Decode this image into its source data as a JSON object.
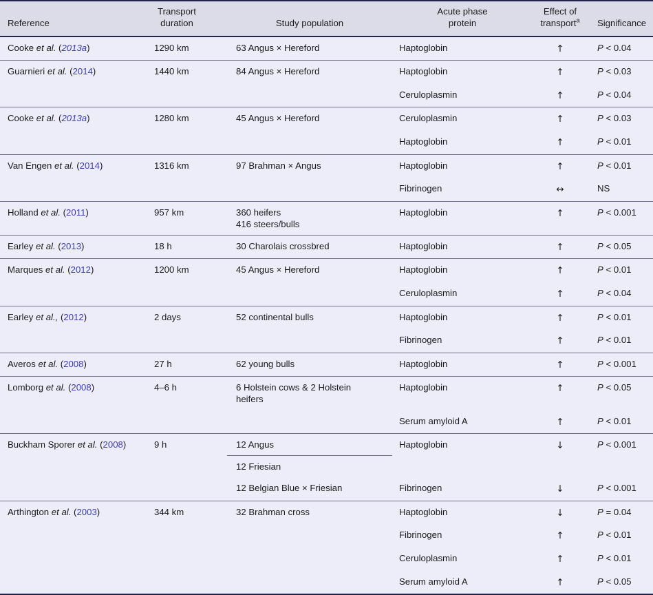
{
  "table": {
    "caption_present": false,
    "columns": [
      {
        "key": "reference",
        "label_line1": "Reference",
        "label_line2": ""
      },
      {
        "key": "duration",
        "label_line1": "Transport",
        "label_line2": "duration"
      },
      {
        "key": "population",
        "label_line1": "Study population",
        "label_line2": ""
      },
      {
        "key": "protein",
        "label_line1": "Acute phase",
        "label_line2": "protein"
      },
      {
        "key": "effect",
        "label_line1": "Effect of",
        "label_line2": "transport",
        "footnote_marker": "a"
      },
      {
        "key": "significance",
        "label_line1": "Significance",
        "label_line2": ""
      }
    ],
    "colors": {
      "header_bg": "#dcdce8",
      "body_bg": "#ededfa",
      "rule_strong": "#23234a",
      "rule_light": "#6e6e86",
      "citation_link": "#3b3bbf",
      "text": "#1a1a1a"
    },
    "symbols": {
      "increase": "↑",
      "decrease": "↓",
      "no_change": "↔",
      "times": "×"
    },
    "rows": [
      {
        "reference": {
          "author": "Cooke et al.",
          "year": "2013a",
          "italic_year": true
        },
        "duration": "1290 km",
        "population": "63 Angus × Hereford",
        "protein": "Haptoglobin",
        "effect": "↑",
        "significance": "P < 0.04",
        "new_group": true
      },
      {
        "reference": {
          "author": "Guarnieri et al.",
          "year": "2014",
          "italic_year": false
        },
        "duration": "1440 km",
        "population": "84 Angus × Hereford",
        "protein": "Haptoglobin",
        "effect": "↑",
        "significance": "P < 0.03",
        "new_group": true
      },
      {
        "reference": {
          "author": "",
          "year": "",
          "italic_year": false
        },
        "duration": "",
        "population": "",
        "protein": "Ceruloplasmin",
        "effect": "↑",
        "significance": "P < 0.04",
        "new_group": false
      },
      {
        "reference": {
          "author": "Cooke et al.",
          "year": "2013a",
          "italic_year": true
        },
        "duration": "1280 km",
        "population": "45 Angus × Hereford",
        "protein": "Ceruloplasmin",
        "effect": "↑",
        "significance": "P < 0.03",
        "new_group": true
      },
      {
        "reference": {
          "author": "",
          "year": "",
          "italic_year": false
        },
        "duration": "",
        "population": "",
        "protein": "Haptoglobin",
        "effect": "↑",
        "significance": "P < 0.01",
        "new_group": false
      },
      {
        "reference": {
          "author": "Van Engen et al.",
          "year": "2014",
          "italic_year": false
        },
        "duration": "1316 km",
        "population": "97 Brahman × Angus",
        "protein": "Haptoglobin",
        "effect": "↑",
        "significance": "P < 0.01",
        "new_group": true
      },
      {
        "reference": {
          "author": "",
          "year": "",
          "italic_year": false
        },
        "duration": "",
        "population": "",
        "protein": "Fibrinogen",
        "effect": "↔",
        "significance": "NS",
        "new_group": false
      },
      {
        "reference": {
          "author": "Holland et al.",
          "year": "2011",
          "italic_year": false
        },
        "duration": "957 km",
        "population": "360 heifers\n416 steers/bulls",
        "protein": "Haptoglobin",
        "effect": "↑",
        "significance": "P < 0.001",
        "new_group": true
      },
      {
        "reference": {
          "author": "Earley et al.",
          "year": "2013",
          "italic_year": false
        },
        "duration": "18 h",
        "population": "30 Charolais crossbred",
        "protein": "Haptoglobin",
        "effect": "↑",
        "significance": "P < 0.05",
        "new_group": true
      },
      {
        "reference": {
          "author": "Marques et al.",
          "year": "2012",
          "italic_year": false
        },
        "duration": "1200 km",
        "population": "45 Angus × Hereford",
        "protein": "Haptoglobin",
        "effect": "↑",
        "significance": "P < 0.01",
        "new_group": true
      },
      {
        "reference": {
          "author": "",
          "year": "",
          "italic_year": false
        },
        "duration": "",
        "population": "",
        "protein": "Ceruloplasmin",
        "effect": "↑",
        "significance": "P < 0.04",
        "new_group": false
      },
      {
        "reference": {
          "author": "Earley et al.,",
          "year": "2012",
          "italic_year": false
        },
        "duration": "2 days",
        "population": "52 continental bulls",
        "protein": "Haptoglobin",
        "effect": "↑",
        "significance": "P < 0.01",
        "new_group": true
      },
      {
        "reference": {
          "author": "",
          "year": "",
          "italic_year": false
        },
        "duration": "",
        "population": "",
        "protein": "Fibrinogen",
        "effect": "↑",
        "significance": "P < 0.01",
        "new_group": false
      },
      {
        "reference": {
          "author": "Averos et al.",
          "year": "2008",
          "italic_year": false
        },
        "duration": "27 h",
        "population": "62 young bulls",
        "protein": "Haptoglobin",
        "effect": "↑",
        "significance": "P < 0.001",
        "new_group": true
      },
      {
        "reference": {
          "author": "Lomborg et al.",
          "year": "2008",
          "italic_year": false
        },
        "duration": "4–6 h",
        "population": "6 Holstein cows & 2 Holstein\nheifers",
        "protein": "Haptoglobin",
        "effect": "↑",
        "significance": "P < 0.05",
        "new_group": true
      },
      {
        "reference": {
          "author": "",
          "year": "",
          "italic_year": false
        },
        "duration": "",
        "population": "",
        "protein": "Serum amyloid A",
        "effect": "↑",
        "significance": "P < 0.01",
        "new_group": false
      },
      {
        "reference": {
          "author": "Buckham Sporer et al.",
          "year": "2008",
          "italic_year": false
        },
        "duration": "9 h",
        "population_a": "12 Angus",
        "population_b": "12 Friesian",
        "protein": "Haptoglobin",
        "effect": "↓",
        "significance": "P < 0.001",
        "new_group": true,
        "split_population": true
      },
      {
        "reference": {
          "author": "",
          "year": "",
          "italic_year": false
        },
        "duration": "",
        "population": "12 Belgian Blue × Friesian",
        "protein": "Fibrinogen",
        "effect": "↓",
        "significance": "P < 0.001",
        "new_group": false
      },
      {
        "reference": {
          "author": "Arthington et al.",
          "year": "2003",
          "italic_year": false
        },
        "duration": "344 km",
        "population": "32 Brahman cross",
        "protein": "Haptoglobin",
        "effect": "↓",
        "significance": "P = 0.04",
        "new_group": true
      },
      {
        "reference": {
          "author": "",
          "year": "",
          "italic_year": false
        },
        "duration": "",
        "population": "",
        "protein": "Fibrinogen",
        "effect": "↑",
        "significance": "P < 0.01",
        "new_group": false
      },
      {
        "reference": {
          "author": "",
          "year": "",
          "italic_year": false
        },
        "duration": "",
        "population": "",
        "protein": "Ceruloplasmin",
        "effect": "↑",
        "significance": "P < 0.01",
        "new_group": false
      },
      {
        "reference": {
          "author": "",
          "year": "",
          "italic_year": false
        },
        "duration": "",
        "population": "",
        "protein": "Serum amyloid A",
        "effect": "↑",
        "significance": "P < 0.05",
        "new_group": false
      }
    ]
  }
}
